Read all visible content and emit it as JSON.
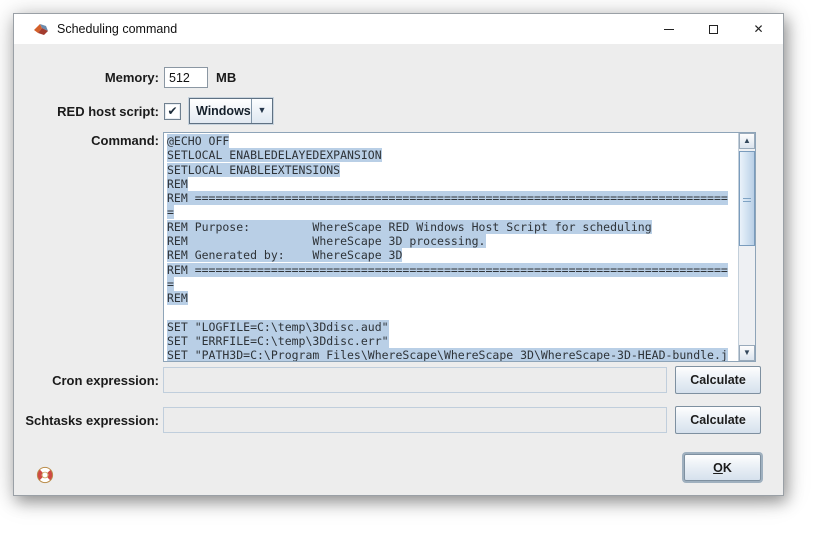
{
  "window": {
    "title": "Scheduling command"
  },
  "icons": {
    "app": "wherescape-3d-logo",
    "close": "✕",
    "checkbox_check": "✔",
    "combo_arrow": "▼",
    "scroll_up": "▲",
    "scroll_down": "▼",
    "help": "life-buoy"
  },
  "form": {
    "memory": {
      "label": "Memory:",
      "value": "512",
      "unit": "MB"
    },
    "red_host_script": {
      "label": "RED host script:",
      "checked": true,
      "selected": "Windows"
    },
    "command": {
      "label": "Command:",
      "lines": [
        {
          "text": "@ECHO OFF",
          "selected": true
        },
        {
          "text": "SETLOCAL ENABLEDELAYEDEXPANSION",
          "selected": true
        },
        {
          "text": "SETLOCAL ENABLEEXTENSIONS",
          "selected": true
        },
        {
          "text": "REM",
          "selected": true
        },
        {
          "text": "REM =============================================================================",
          "selected": true
        },
        {
          "text": "=",
          "selected": true
        },
        {
          "text": "REM Purpose:         WhereScape RED Windows Host Script for scheduling",
          "selected": true
        },
        {
          "text": "REM                  WhereScape 3D processing.",
          "selected": true
        },
        {
          "text": "REM Generated by:    WhereScape 3D",
          "selected": true
        },
        {
          "text": "REM =============================================================================",
          "selected": true
        },
        {
          "text": "=",
          "selected": true
        },
        {
          "text": "REM",
          "selected": true
        },
        {
          "text": "",
          "selected": false
        },
        {
          "text": "SET \"LOGFILE=C:\\temp\\3Ddisc.aud\"",
          "selected": true
        },
        {
          "text": "SET \"ERRFILE=C:\\temp\\3Ddisc.err\"",
          "selected": true
        },
        {
          "text": "SET \"PATH3D=C:\\Program Files\\WhereScape\\WhereScape 3D\\WhereScape-3D-HEAD-bundle.j",
          "selected": true
        }
      ]
    },
    "cron": {
      "label": "Cron expression:",
      "value": "",
      "button": "Calculate"
    },
    "schtasks": {
      "label": "Schtasks expression:",
      "value": "",
      "button": "Calculate"
    }
  },
  "footer": {
    "ok_mnemonic": "O",
    "ok_rest": "K"
  },
  "colors": {
    "selection": "#b9cfe6",
    "dialog_bg": "#ededed",
    "titlebar_bg": "#ffffff",
    "code_text": "#2e3338",
    "accent_border": "#5f7183"
  }
}
